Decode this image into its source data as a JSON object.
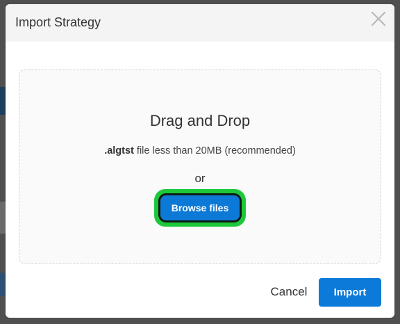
{
  "dialog": {
    "title": "Import Strategy",
    "close_icon": "close-icon"
  },
  "dropzone": {
    "heading": "Drag and Drop",
    "hint_extension": ".algtst",
    "hint_text": " file less than 20MB (recommended)",
    "or_text": "or",
    "browse_label": "Browse files"
  },
  "footer": {
    "cancel_label": "Cancel",
    "import_label": "Import"
  },
  "colors": {
    "primary": "#0c7ad8",
    "highlight": "#1dc83b",
    "header_bg": "#f4f4f4"
  }
}
